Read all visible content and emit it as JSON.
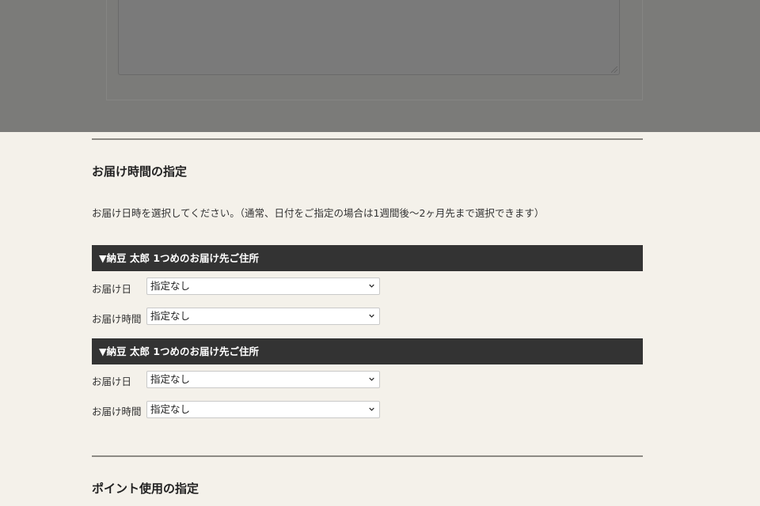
{
  "delivery": {
    "title": "お届け時間の指定",
    "description": "お届け日時を選択してください。（通常、日付をご指定の場合は1週間後～2ヶ月先まで選択できます）",
    "addresses": [
      {
        "header": "▼納豆 太郎 1つめのお届け先ご住所",
        "date_label": "お届け日",
        "date_value": "指定なし",
        "time_label": "お届け時間",
        "time_value": "指定なし"
      },
      {
        "header": "▼納豆 太郎 1つめのお届け先ご住所",
        "date_label": "お届け日",
        "date_value": "指定なし",
        "time_label": "お届け時間",
        "time_value": "指定なし"
      }
    ]
  },
  "points": {
    "title": "ポイント使用の指定"
  },
  "icons": {
    "select_arrow": "chevron-down-icon"
  },
  "colors": {
    "page_bg": "#f4f1ea",
    "overlay": "#7b7b79",
    "bar_bg": "#333333"
  }
}
